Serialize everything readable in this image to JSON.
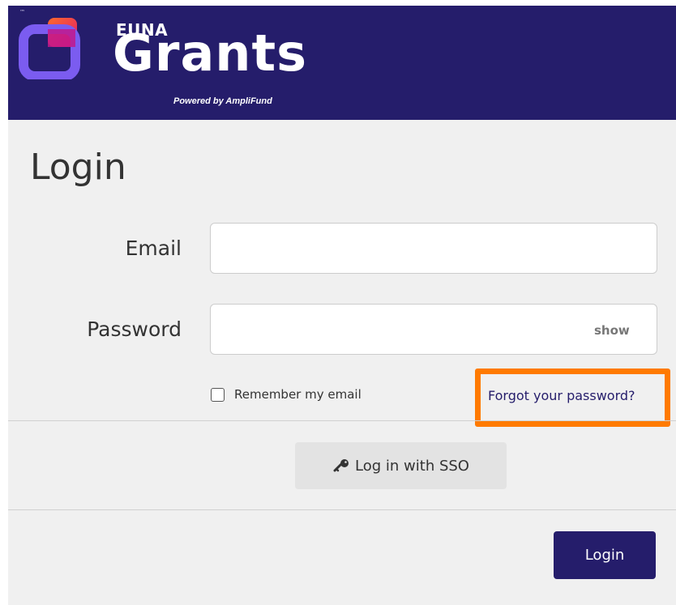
{
  "brand": {
    "tm": "™",
    "euna": "EUNA",
    "grants": "Grants",
    "powered_by": "Powered by AmpliFund"
  },
  "page": {
    "title": "Login"
  },
  "form": {
    "email_label": "Email",
    "email_value": "",
    "password_label": "Password",
    "password_value": "",
    "show_label": "show",
    "remember_label": "Remember my email",
    "remember_checked": false,
    "forgot_label": "Forgot your password?",
    "sso_label": "Log in with SSO",
    "login_label": "Login"
  },
  "colors": {
    "brand_navy": "#251d6b",
    "highlight_orange": "#ff7a00",
    "panel_bg": "#f0f0f0"
  },
  "icons": {
    "logo": "euna-logo-icon",
    "key": "key-icon"
  }
}
